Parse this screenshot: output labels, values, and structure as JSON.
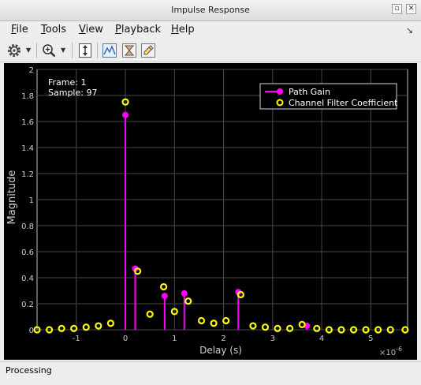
{
  "window": {
    "title": "Impulse Response"
  },
  "menu": [
    {
      "label": "File",
      "underline": "F",
      "rest": "ile"
    },
    {
      "label": "Tools",
      "underline": "T",
      "rest": "ools"
    },
    {
      "label": "View",
      "underline": "V",
      "rest": "iew"
    },
    {
      "label": "Playback",
      "underline": "P",
      "rest": "layback"
    },
    {
      "label": "Help",
      "underline": "H",
      "rest": "elp"
    }
  ],
  "toolbar": {
    "icons": [
      "gear-icon",
      "zoom-in-icon",
      "scale-axes-icon",
      "signal-statistics-icon",
      "triggers-icon",
      "edit-icon"
    ]
  },
  "plot": {
    "info_frame": "Frame: 1",
    "info_sample": "Sample: 97",
    "multiplier": "×10",
    "multiplier_exp": "-6"
  },
  "chart_data": {
    "type": "scatter",
    "xlabel": "Delay (s)",
    "ylabel": "Magnitude",
    "xlim": [
      -1.8e-06,
      5.75e-06
    ],
    "ylim": [
      0,
      2
    ],
    "xticks": [
      -1,
      0,
      1,
      2,
      3,
      4,
      5
    ],
    "yticks": [
      "0",
      "0.2",
      "0.4",
      "0.6",
      "0.8",
      "1",
      "1.2",
      "1.4",
      "1.6",
      "1.8",
      "2"
    ],
    "grid": true,
    "legend_position": "top-right",
    "series": [
      {
        "name": "Path Gain",
        "style": "stem",
        "color": "#ff00ff",
        "x": [
          0,
          0.2,
          0.8,
          1.2,
          2.3,
          3.7
        ],
        "y": [
          1.65,
          0.47,
          0.26,
          0.28,
          0.29,
          0.03
        ]
      },
      {
        "name": "Channel Filter Coefficient",
        "style": "markers",
        "color": "#ffff00",
        "x": [
          -1.8,
          -1.55,
          -1.3,
          -1.05,
          -0.8,
          -0.55,
          -0.3,
          0,
          0.25,
          0.5,
          0.78,
          1.0,
          1.28,
          1.55,
          1.8,
          2.05,
          2.35,
          2.6,
          2.85,
          3.1,
          3.35,
          3.6,
          3.9,
          4.15,
          4.4,
          4.65,
          4.9,
          5.15,
          5.4,
          5.7
        ],
        "y": [
          0,
          0,
          0.01,
          0.01,
          0.02,
          0.03,
          0.05,
          1.75,
          0.45,
          0.12,
          0.33,
          0.14,
          0.22,
          0.07,
          0.05,
          0.07,
          0.27,
          0.03,
          0.02,
          0.01,
          0.01,
          0.04,
          0.01,
          0,
          0,
          0,
          0,
          0,
          0,
          0
        ]
      }
    ]
  },
  "status": {
    "text": "Processing"
  }
}
